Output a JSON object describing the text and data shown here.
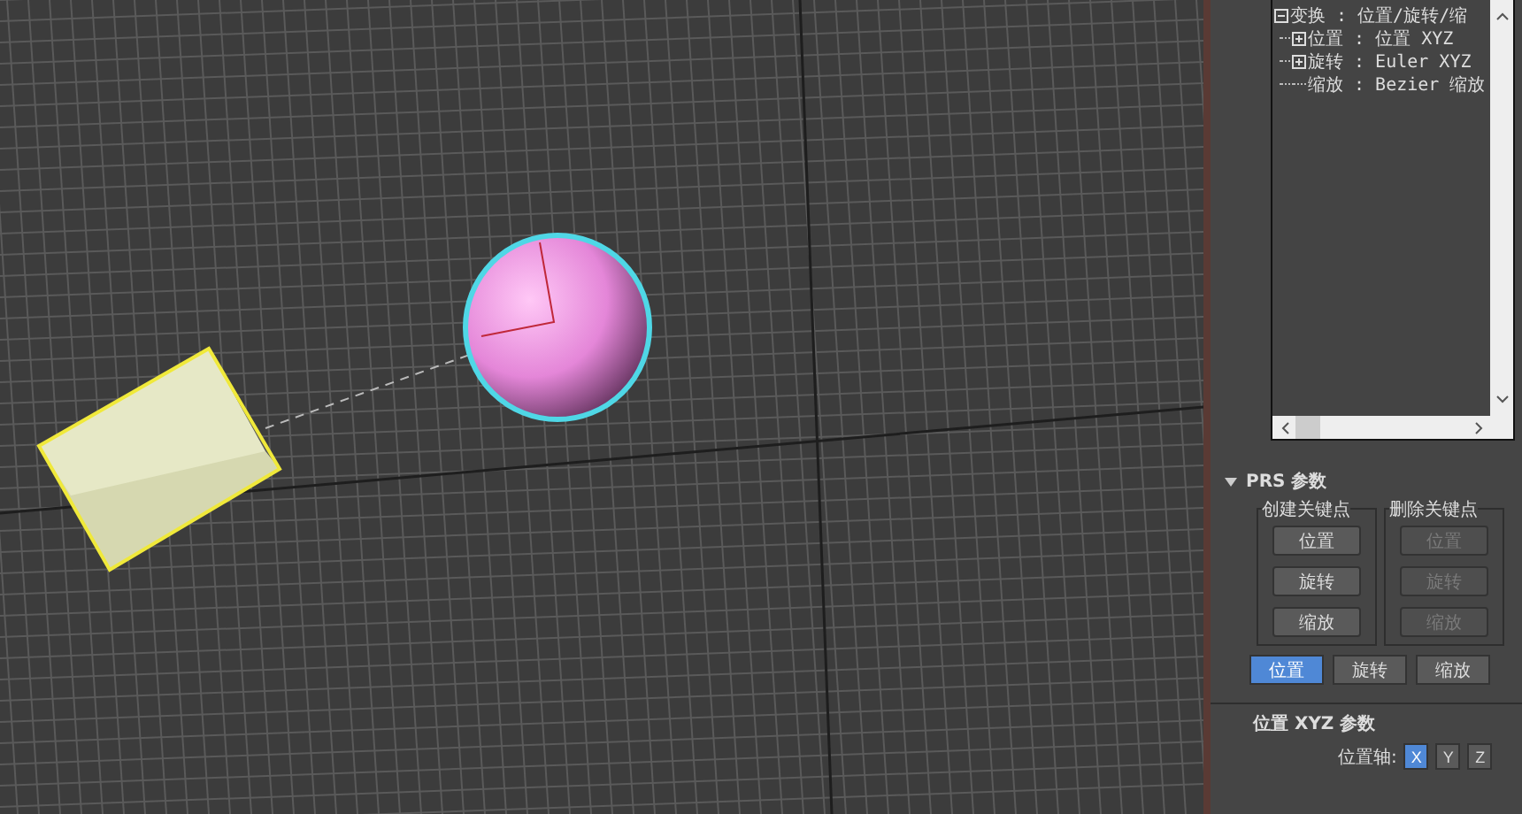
{
  "tree": {
    "items": [
      {
        "label": "变换 : 位置/旋转/缩",
        "kind": "group",
        "expanded": true,
        "children": [
          {
            "label": "位置 : 位置 XYZ",
            "kind": "group",
            "expanded": false
          },
          {
            "label": "旋转 : Euler XYZ",
            "kind": "group",
            "expanded": false
          },
          {
            "label": "缩放 : Bezier 缩放",
            "kind": "leaf"
          }
        ]
      }
    ]
  },
  "prs_rollout": {
    "title": "PRS 参数",
    "expanded": true,
    "create_keys": {
      "title": "创建关键点",
      "buttons": [
        {
          "label": "位置",
          "disabled": false
        },
        {
          "label": "旋转",
          "disabled": false
        },
        {
          "label": "缩放",
          "disabled": false
        }
      ]
    },
    "delete_keys": {
      "title": "删除关键点",
      "buttons": [
        {
          "label": "位置",
          "disabled": true
        },
        {
          "label": "旋转",
          "disabled": true
        },
        {
          "label": "缩放",
          "disabled": true
        }
      ]
    },
    "tabs": [
      {
        "label": "位置",
        "selected": true
      },
      {
        "label": "旋转",
        "selected": false
      },
      {
        "label": "缩放",
        "selected": false
      }
    ]
  },
  "xyz_rollout": {
    "title": "位置 XYZ 参数",
    "axis_label": "位置轴:",
    "axes": [
      {
        "label": "X",
        "selected": true
      },
      {
        "label": "Y",
        "selected": false
      },
      {
        "label": "Z",
        "selected": false
      }
    ]
  }
}
